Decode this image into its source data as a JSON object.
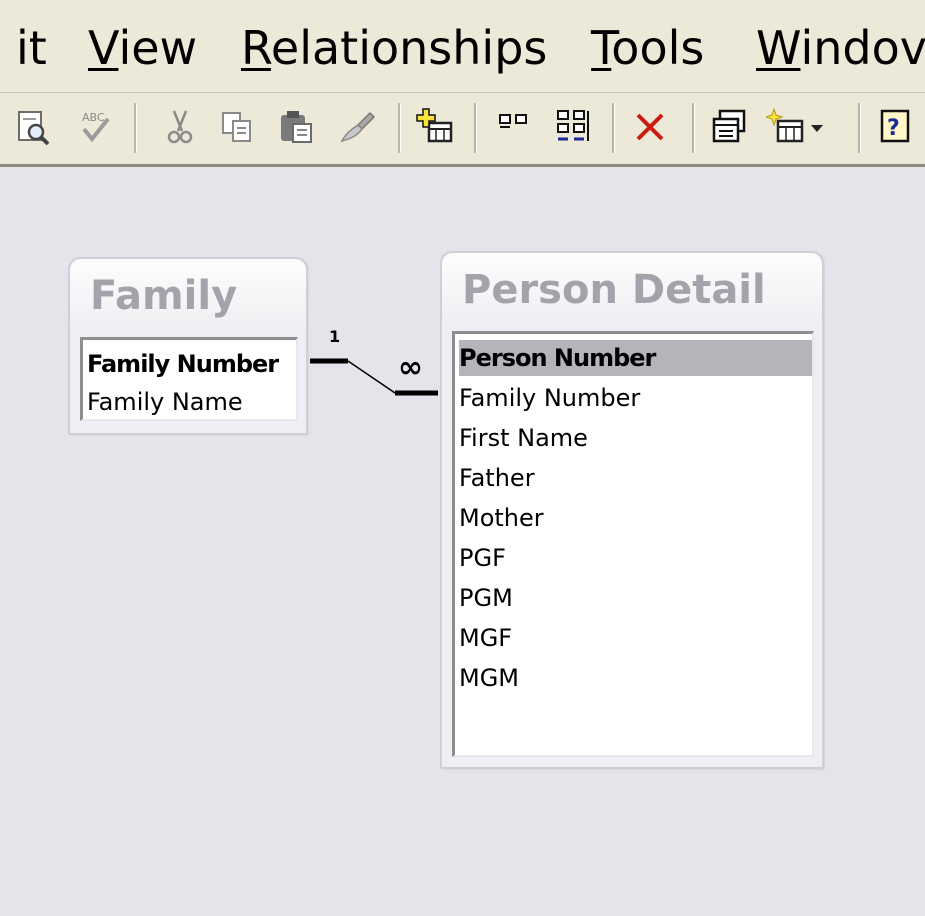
{
  "menu": {
    "items": [
      {
        "prefix": "it",
        "underline": "",
        "rest": ""
      },
      {
        "prefix": "",
        "underline": "V",
        "rest": "iew"
      },
      {
        "prefix": "",
        "underline": "R",
        "rest": "elationships"
      },
      {
        "prefix": "",
        "underline": "T",
        "rest": "ools"
      },
      {
        "prefix": "",
        "underline": "W",
        "rest": "indov"
      }
    ]
  },
  "toolbar": {
    "buttons": [
      "print-preview-icon",
      "spelling-icon",
      "cut-icon",
      "copy-icon",
      "paste-icon",
      "format-painter-icon",
      "show-table-icon",
      "show-direct-relationships-icon",
      "show-all-relationships-icon",
      "delete-icon",
      "database-window-icon",
      "new-object-icon",
      "help-icon"
    ]
  },
  "tables": {
    "family": {
      "title": "Family",
      "fields": [
        "Family Number",
        "Family Name"
      ]
    },
    "person_detail": {
      "title": "Person Detail",
      "fields": [
        "Person Number",
        "Family Number",
        "First Name",
        "Father",
        "Mother",
        "PGF",
        "PGM",
        "MGF",
        "MGM"
      ]
    }
  },
  "relationship": {
    "one_label": "1",
    "many_label": "∞"
  },
  "colors": {
    "chrome": "#ece9d8",
    "workspace": "#e5e4ea",
    "delete_red": "#cc1b10",
    "title_text": "#a3a4ab",
    "selected_row": "#b4b4bb"
  }
}
